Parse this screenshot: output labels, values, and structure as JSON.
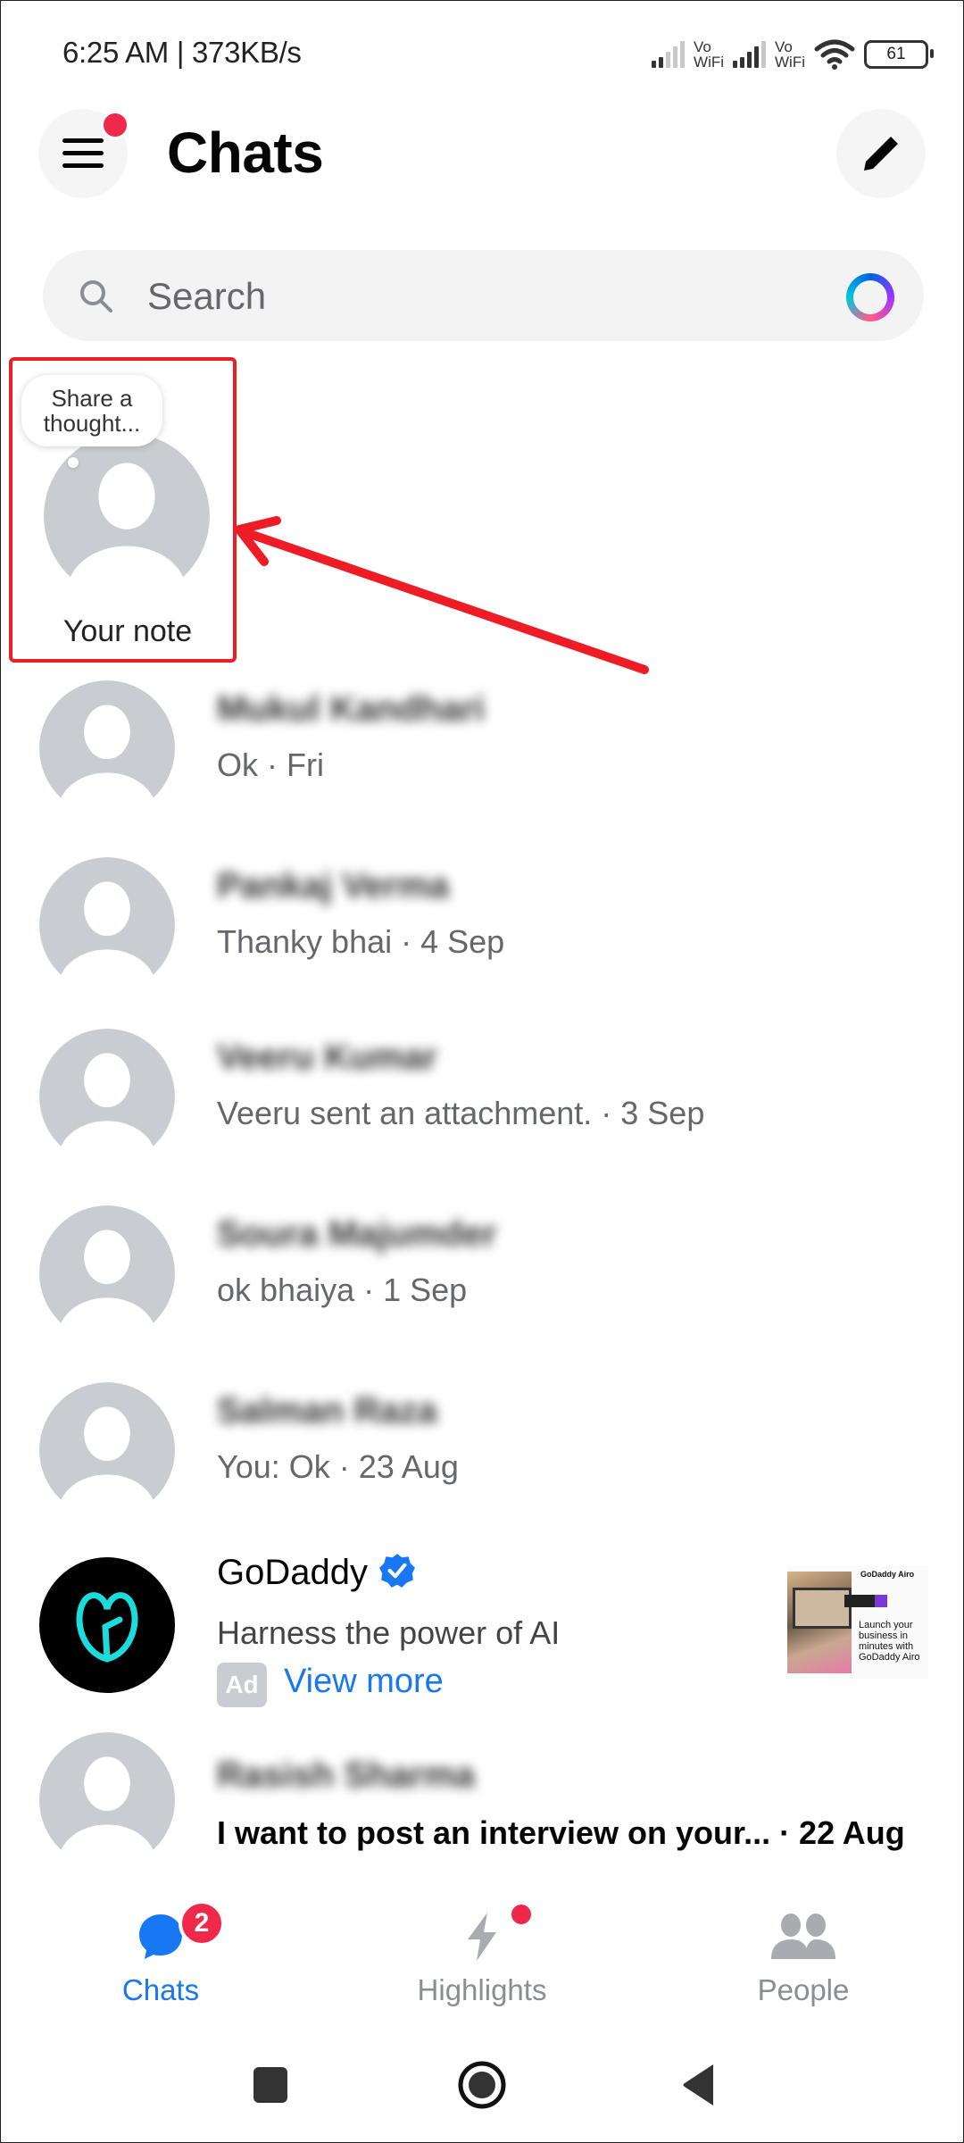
{
  "status_bar": {
    "time_speed": "6:25 AM | 373KB/s",
    "sim1_label": [
      "Vo",
      "WiFi"
    ],
    "sim2_label": [
      "Vo",
      "WiFi"
    ],
    "battery_level": "61"
  },
  "header": {
    "title": "Chats",
    "menu_icon": "hamburger-menu-icon",
    "menu_has_notification": true,
    "compose_icon": "pencil-icon"
  },
  "search": {
    "placeholder": "Search",
    "icon": "search-icon",
    "ai_icon": "meta-ai-ring-icon"
  },
  "note": {
    "bubble_line1": "Share a",
    "bubble_line2": "thought...",
    "label": "Your note"
  },
  "chats": [
    {
      "name": "Mukul Kandhari",
      "message": "Ok · Fri",
      "unread": false
    },
    {
      "name": "Pankaj Verma",
      "message": "Thanky bhai · 4 Sep",
      "unread": false
    },
    {
      "name": "Veeru Kumar",
      "message": "Veeru sent an attachment. · 3 Sep",
      "unread": false
    },
    {
      "name": "Soura Majumder",
      "message": "ok bhaiya · 1 Sep",
      "unread": false
    },
    {
      "name": "Salman Raza",
      "message": "You: Ok · 23 Aug",
      "unread": false
    }
  ],
  "ad": {
    "name": "GoDaddy",
    "verified": true,
    "message": "Harness the power of AI",
    "badge": "Ad",
    "cta": "View more",
    "thumb_brand": "GoDaddy Airo",
    "thumb_copy": "Launch your business in minutes with GoDaddy Airo"
  },
  "last_chat": {
    "name": "Rasish Sharma",
    "message": "I want to post an interview on your...  · 22 Aug",
    "unread": true
  },
  "bottom_nav": {
    "tabs": [
      {
        "label": "Chats",
        "active": true,
        "badge": "2"
      },
      {
        "label": "Highlights",
        "active": false,
        "dot": true
      },
      {
        "label": "People",
        "active": false
      }
    ]
  },
  "colors": {
    "accent": "#1877f2",
    "badge_red": "#f02849",
    "annotation_red": "#ee1c25",
    "secondary_text": "#65676b",
    "avatar_gray": "#c9ccd1"
  }
}
